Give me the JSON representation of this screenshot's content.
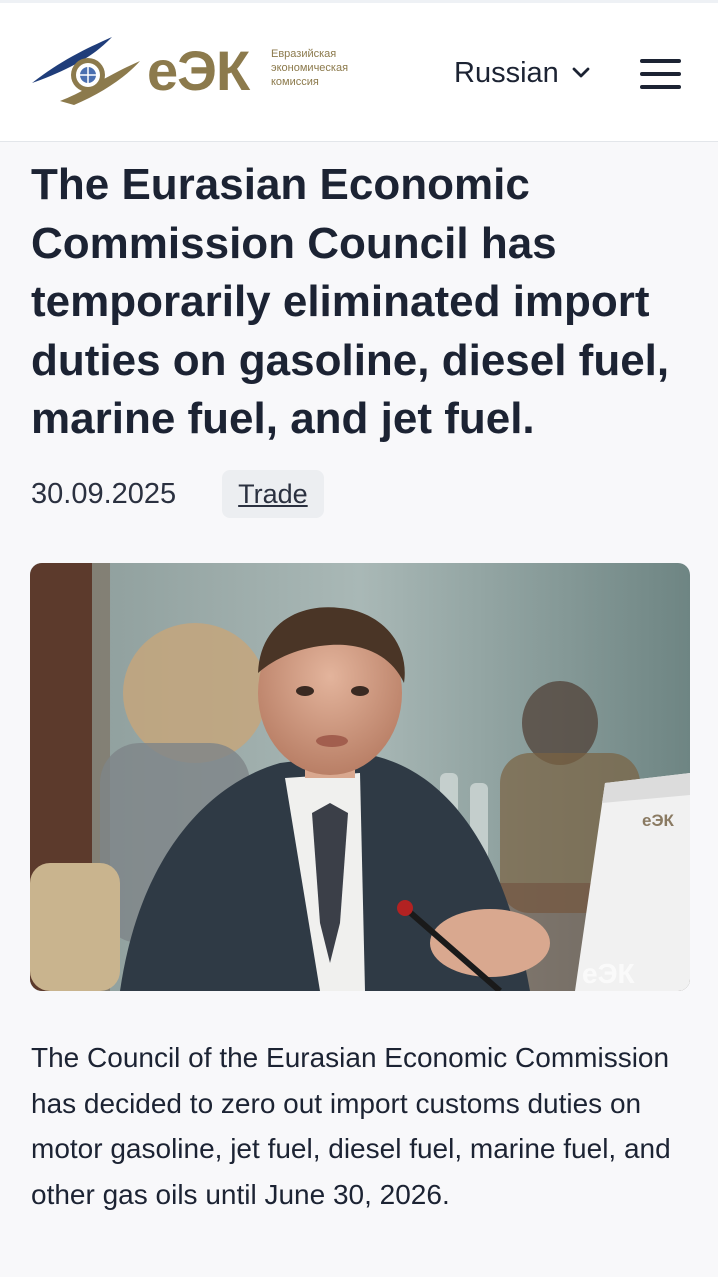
{
  "header": {
    "logo_mark": "еЭК",
    "logo_caption": [
      "Евразийская",
      "экономическая",
      "комиссия"
    ],
    "language_label": "Russian"
  },
  "article": {
    "title": "The Eurasian Economic Commission Council has temporarily eliminated import duties on gasoline, diesel fuel, marine fuel, and jet fuel.",
    "date": "30.09.2025",
    "tag": "Trade",
    "photo_watermark": "еЭК",
    "monitor_logo": "еЭК",
    "body": "The Council of the Eurasian Economic Commission has decided to zero out import customs duties on motor gasoline, jet fuel, diesel fuel, marine fuel, and other gas oils until June 30, 2026."
  },
  "colors": {
    "brand_gold": "#8c7a4c",
    "brand_navy": "#1f3d7a",
    "text_dark": "#1c2333",
    "tag_bg": "#eceef1"
  },
  "icons": {
    "language_toggle": "chevron-down-icon",
    "menu": "hamburger-menu-icon",
    "logo": "eec-emblem-icon"
  }
}
